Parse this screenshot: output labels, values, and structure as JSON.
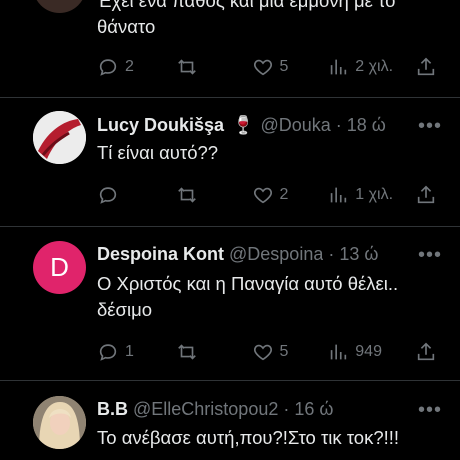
{
  "tweets": [
    {
      "name": "",
      "handle": "",
      "time": "",
      "text": "Έχει ένα πάθος και μια εμμονή με το\nθάνατο",
      "replies": "2",
      "retweets": "",
      "likes": "5",
      "views": "2 χιλ."
    },
    {
      "name": "Lucy Doukišşa",
      "emoji": "🍷",
      "handle": "@Douka",
      "time": "18 ώ",
      "text": "Τί είναι αυτό??",
      "replies": "",
      "retweets": "",
      "likes": "2",
      "views": "1 χιλ."
    },
    {
      "name": "Despoina Kont",
      "avatar_letter": "D",
      "avatar_color": "#e0246b",
      "handle": "@Despoina",
      "time": "13 ώ",
      "text": "Ο Χριστός και η Παναγία αυτό θέλει..\nδέσιμο",
      "replies": "1",
      "retweets": "",
      "likes": "5",
      "views": "949"
    },
    {
      "name": "B.B",
      "handle": "@ElleChristopou2",
      "time": "16 ώ",
      "text": "Το ανέβασε αυτή,που?!Στο τικ τοκ?!!!"
    }
  ],
  "colors": {
    "background": "#000000",
    "text": "#e7e9ea",
    "muted": "#71767b",
    "divider": "#2f3336"
  },
  "icons": [
    "reply-icon",
    "retweet-icon",
    "like-icon",
    "views-icon",
    "share-icon",
    "more-icon"
  ]
}
